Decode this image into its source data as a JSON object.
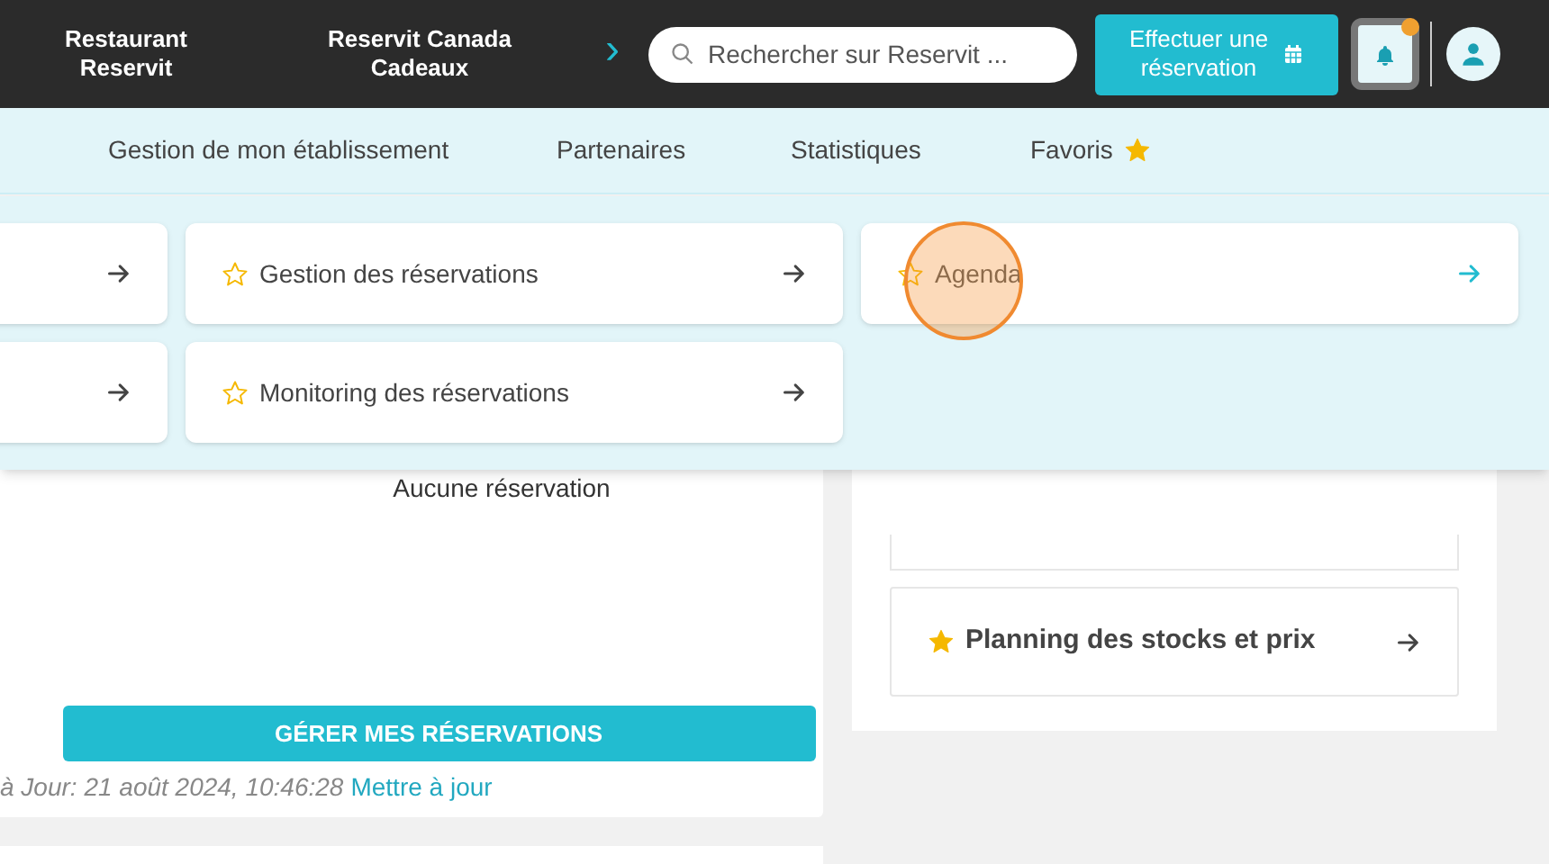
{
  "top_bar": {
    "links": [
      "Restaurant\nReservit",
      "Reservit Canada\nCadeaux"
    ],
    "scroll_arrow": "›",
    "search": {
      "placeholder": "Rechercher sur Reservit ..."
    },
    "book_button": "Effectuer une\nréservation",
    "notifications": {
      "unread": true
    }
  },
  "nav": {
    "items": [
      {
        "label": "Gestion de mon établissement",
        "favorite": false
      },
      {
        "label": "Partenaires",
        "favorite": false
      },
      {
        "label": "Statistiques",
        "favorite": false
      },
      {
        "label": "Favoris",
        "favorite": true
      }
    ]
  },
  "menu_panel": {
    "columns": [
      [
        {
          "hovered": false
        },
        {
          "hovered": false
        }
      ],
      [
        {
          "label": "Gestion des réservations",
          "favorite": false,
          "hovered": false
        },
        {
          "label": "Monitoring des réservations",
          "favorite": false,
          "hovered": false
        }
      ],
      [
        {
          "label": "Agenda",
          "favorite": false,
          "hovered": true
        }
      ]
    ]
  },
  "reservations_card": {
    "empty_text": "Aucune réservation",
    "button": "GÉRER MES RÉSERVATIONS",
    "updated": "à Jour: 21 août 2024, 10:46:28",
    "refresh_link": "Mettre à jour"
  },
  "shortcuts_card": {
    "items": [
      {
        "label": "Planning des stocks et prix",
        "favorite": true
      }
    ]
  }
}
